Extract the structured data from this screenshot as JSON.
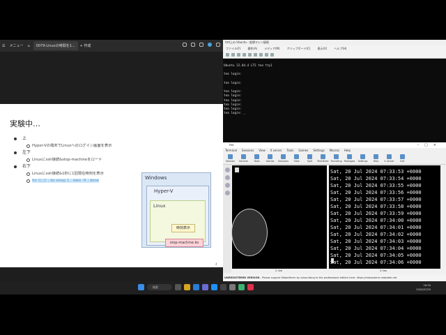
{
  "browser": {
    "menu_label": "メニュー",
    "tab_title": "0079-Linuxの時間を1...",
    "new_tab_label": "+ 作成"
  },
  "slide": {
    "title": "実験中…",
    "bullets": [
      {
        "label": "上",
        "sub": "Hyper-Vの端末でLinuxへのログイン画面を表示"
      },
      {
        "label": "左下",
        "sub": "Linuxにssh接続&stop-machineをロード"
      },
      {
        "label": "右下",
        "sub": "Linuxにssh接続&1秒に1回現在時刻を表示"
      }
    ],
    "command": "for ((;;)) ; do sleep 1 ; date -R ; done",
    "diagram": {
      "windows": "Windows",
      "hyperv": "Hyper-V",
      "linux": "Linux",
      "time_box": "時刻表示",
      "stop_box": "stop-machine.ko"
    },
    "page_number": "4"
  },
  "vm_terminal": {
    "title": "tmt上の Ubuntu - 仮想マシン接続",
    "menu": [
      "ファイル(F)",
      "操作(A)",
      "メディア(M)",
      "クリップボード(C)",
      "表示(V)",
      "ヘルプ(H)"
    ],
    "lines": [
      "Ubuntu 22.04.4 LTS tea tty1",
      "",
      "tea login:",
      "",
      "tea login:",
      "",
      "tea login:",
      "tea login:",
      "tea login:",
      "tea login:",
      "tea login:",
      "tea login: _"
    ]
  },
  "mobaxterm": {
    "title": "tea",
    "menu": [
      "Terminal",
      "Sessions",
      "View",
      "X server",
      "Tools",
      "Games",
      "Settings",
      "Macros",
      "Help"
    ],
    "toolbar": [
      "Session",
      "Servers",
      "Tools",
      "Games",
      "Sessions",
      "View",
      "Split",
      "MultiExec",
      "Tunneling",
      "Packages",
      "Settings",
      "Help",
      "X server",
      "Exit"
    ],
    "left_pane_label": "2. tea",
    "right_pane_label": "3. tea",
    "dates": [
      "Sat, 20 Jul 2024 07:33:53 +0000",
      "Sat, 20 Jul 2024 07:33:54 +0000",
      "Sat, 20 Jul 2024 07:33:55 +0000",
      "Sat, 20 Jul 2024 07:33:56 +0000",
      "Sat, 20 Jul 2024 07:33:57 +0000",
      "Sat, 20 Jul 2024 07:33:58 +0000",
      "Sat, 20 Jul 2024 07:33:59 +0000",
      "Sat, 20 Jul 2024 07:34:00 +0000",
      "Sat, 20 Jul 2024 07:34:01 +0000",
      "Sat, 20 Jul 2024 07:34:02 +0000",
      "Sat, 20 Jul 2024 07:34:03 +0000",
      "Sat, 20 Jul 2024 07:34:04 +0000",
      "Sat, 20 Jul 2024 07:34:05 +0000",
      "Sat, 20 Jul 2024 07:34:06 +0000"
    ],
    "unregistered": "UNREGISTERED VERSION",
    "unregistered_msg": "- Please support MobaXterm by subscribing to the professional edition here: https://mobaxterm.mobatek.net"
  },
  "taskbar": {
    "search_label": "検索",
    "time": "16:34",
    "date": "2024/07/20"
  }
}
